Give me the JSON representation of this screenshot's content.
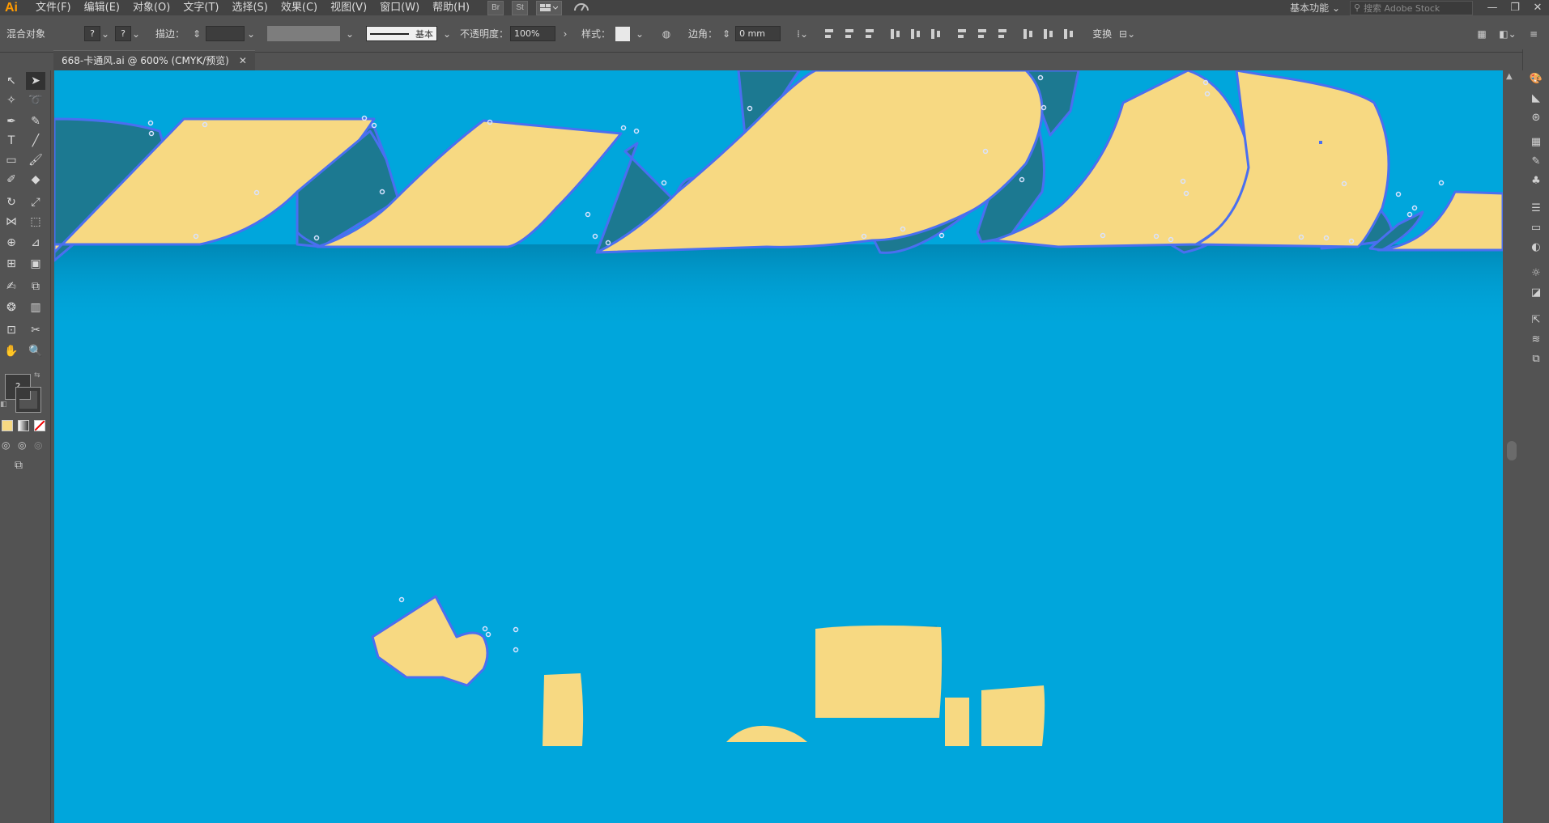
{
  "app": {
    "logo": "Ai"
  },
  "menu": [
    "文件(F)",
    "编辑(E)",
    "对象(O)",
    "文字(T)",
    "选择(S)",
    "效果(C)",
    "视图(V)",
    "窗口(W)",
    "帮助(H)"
  ],
  "menubar_buttons": [
    "Br",
    "St"
  ],
  "workspace": "基本功能",
  "search_placeholder": "搜索 Adobe Stock",
  "window_controls": [
    "—",
    "❐",
    "✕"
  ],
  "control_bar": {
    "object_type": "混合对象",
    "stroke_label": "描边：",
    "stroke_profile": "基本",
    "opacity_label": "不透明度：",
    "opacity_value": "100%",
    "style_label": "样式：",
    "corner_label": "边角：",
    "corner_value": "0 mm",
    "transform_label": "变换"
  },
  "document_tab": {
    "title": "668-卡通风.ai @ 600% (CMYK/预览)",
    "close": "✕"
  },
  "colors": {
    "canvas": "#00a6dc",
    "ribbon_face": "#f7d982",
    "ribbon_fold": "#1c7991",
    "selection": "#4a6ff0"
  },
  "icons": {
    "tools": [
      "selection-tool-icon",
      "direct-selection-tool-icon",
      "magic-wand-icon",
      "lasso-icon",
      "pen-icon",
      "curvature-icon",
      "type-icon",
      "line-icon",
      "rectangle-icon",
      "paintbrush-icon",
      "shaper-icon",
      "eraser-icon",
      "rotate-icon",
      "scale-icon",
      "width-icon",
      "free-transform-icon",
      "shape-builder-icon",
      "perspective-icon",
      "mesh-icon",
      "gradient-icon",
      "eyedropper-icon",
      "blend-icon",
      "symbol-sprayer-icon",
      "column-graph-icon",
      "artboard-icon",
      "slice-icon",
      "hand-icon",
      "zoom-icon"
    ]
  }
}
